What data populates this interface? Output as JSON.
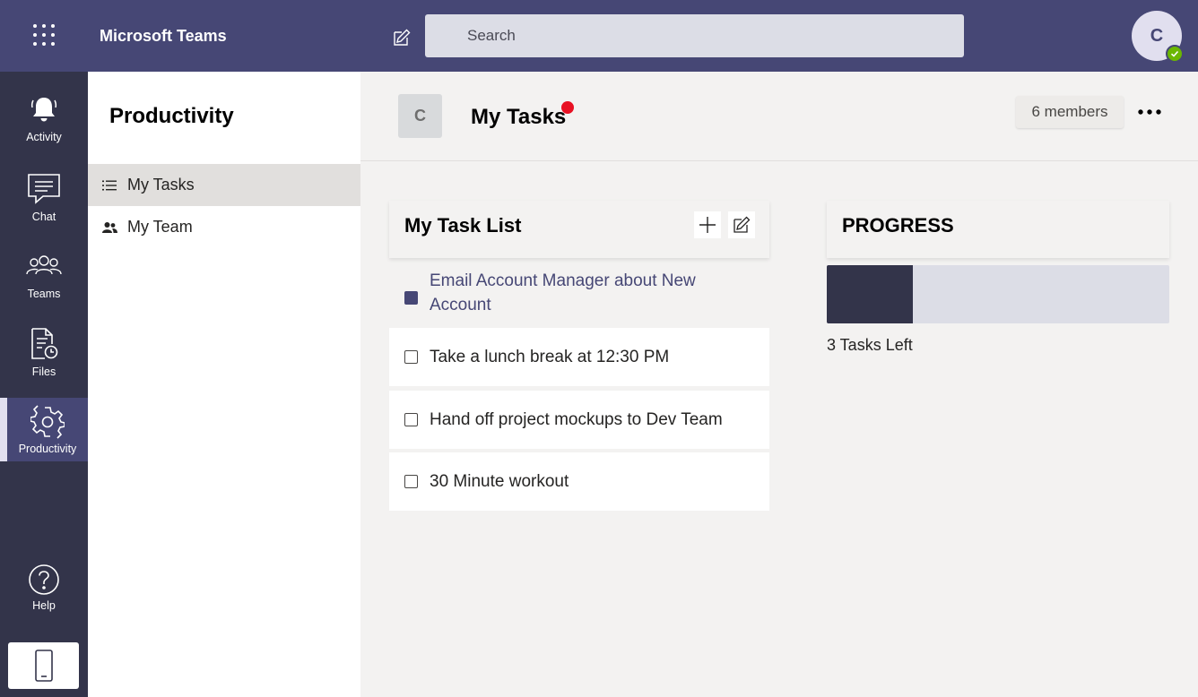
{
  "header": {
    "app_title": "Microsoft Teams",
    "search_placeholder": "Search",
    "user_initial": "C",
    "icons": {
      "waffle": "app-launcher-icon",
      "compose": "compose-icon",
      "presence": "available-check-icon"
    }
  },
  "rail": {
    "items": [
      {
        "label": "Activity",
        "icon": "bell-icon"
      },
      {
        "label": "Chat",
        "icon": "chat-bubble-icon"
      },
      {
        "label": "Teams",
        "icon": "people-group-icon"
      },
      {
        "label": "Files",
        "icon": "file-clock-icon"
      },
      {
        "label": "Productivity",
        "icon": "gear-icon",
        "active": true
      },
      {
        "label": "Help",
        "icon": "help-circle-icon"
      }
    ],
    "device_icon": "mobile-phone-icon"
  },
  "left_panel": {
    "title": "Productivity",
    "nav": [
      {
        "label": "My Tasks",
        "icon": "list-icon",
        "selected": true
      },
      {
        "label": "My Team",
        "icon": "team-icon",
        "selected": false
      }
    ]
  },
  "main": {
    "team_initial": "C",
    "title": "My Tasks",
    "members_label": "6 members",
    "more_icon": "more-options-icon"
  },
  "task_list": {
    "title": "My Task List",
    "add_icon": "plus-icon",
    "edit_icon": "edit-icon",
    "tasks": [
      {
        "text": "Email Account Manager about New Account",
        "done": true
      },
      {
        "text": "Take a lunch break at 12:30 PM",
        "done": false
      },
      {
        "text": "Hand off project mockups to Dev Team",
        "done": false
      },
      {
        "text": "30 Minute workout",
        "done": false
      }
    ]
  },
  "progress": {
    "title": "PROGRESS",
    "completed_fraction": 0.25,
    "tasks_left_label": "3 Tasks Left"
  },
  "colors": {
    "topbar": "#464775",
    "rail": "#33344a",
    "accent": "#464775",
    "notification": "#e81123",
    "presence": "#6bb700"
  }
}
